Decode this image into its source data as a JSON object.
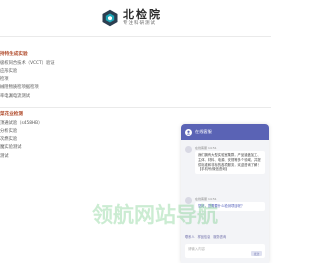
{
  "brand": {
    "title": "北检院",
    "subtitle": "专注科研测试"
  },
  "sections": [
    {
      "title": "持特生成实验",
      "items": [
        "极权同合技术（VCCT）验证",
        "应形实验",
        "检项",
        "械阻物质检项据检项",
        "率电漏电流测试"
      ]
    },
    {
      "title": "菜花业检测",
      "items": [
        "顶通试验（s458HB）",
        "分析实验",
        "次燃实验",
        "魔实验测试",
        "测试"
      ]
    }
  ],
  "chat": {
    "header_title": "在线客服",
    "messages": [
      {
        "sender": "在线客服",
        "time": "14:51",
        "text": "我们拥有大型实验室集群，产品涵盖加工、主体、材料、电源、安规等多个领域，并提供标准和非标的各项服务，欢迎咨询了解！【手机号/微信咨询】"
      },
      {
        "sender": "在线客服",
        "time": "14:51",
        "text": "您好，您需要什么检测项目呢？"
      }
    ],
    "quick_options": [
      "联系人",
      "样品信息",
      "服务咨询"
    ],
    "input_placeholder": "请输入内容",
    "send_label": "发送"
  },
  "watermark": "领航网站导航"
}
